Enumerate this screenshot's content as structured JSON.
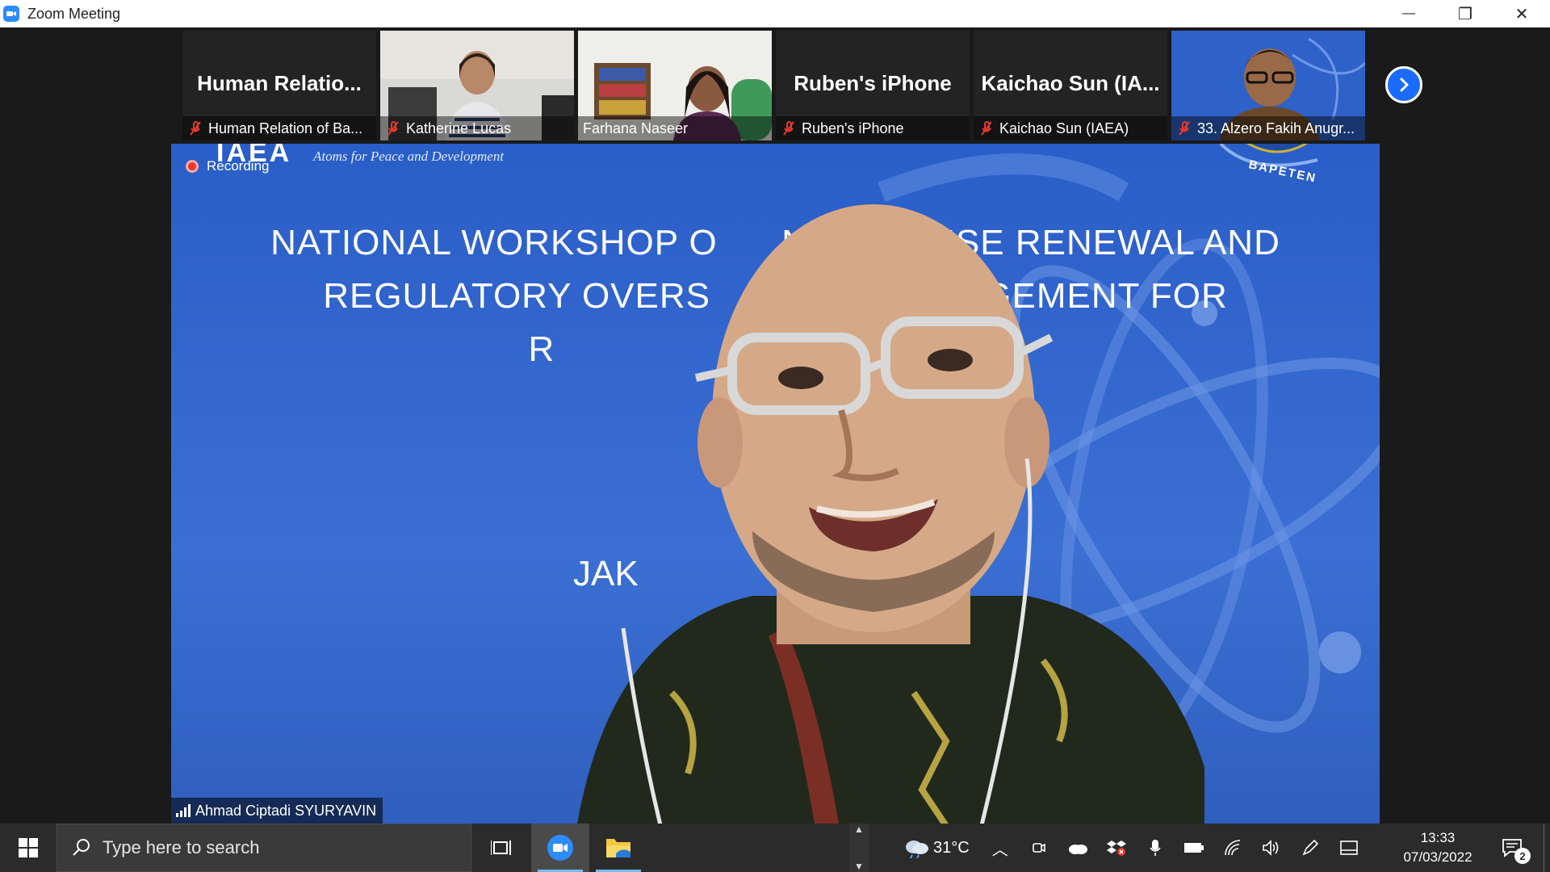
{
  "window": {
    "title": "Zoom Meeting",
    "controls": {
      "minimize": "—",
      "restore": "❐",
      "close": "✕"
    }
  },
  "thumbnails": [
    {
      "display_name": "Human  Relatio...",
      "label": "Human Relation of Ba...",
      "muted": true,
      "has_video": false
    },
    {
      "display_name": "",
      "label": "Katherine Lucas",
      "muted": true,
      "has_video": true
    },
    {
      "display_name": "",
      "label": "Farhana Naseer",
      "muted": false,
      "has_video": true
    },
    {
      "display_name": "Ruben's iPhone",
      "label": "Ruben's iPhone",
      "muted": true,
      "has_video": false
    },
    {
      "display_name": "Kaichao  Sun  (IA...",
      "label": "Kaichao Sun (IAEA)",
      "muted": true,
      "has_video": false
    },
    {
      "display_name": "",
      "label": "33. Alzero Fakih Anugr...",
      "muted": true,
      "has_video": true
    }
  ],
  "main": {
    "recording_label": "Recording",
    "slide_header": "IAEA",
    "slide_subheader": "Atoms for Peace and Development",
    "slide_title_line1": "NATIONAL WORKSHOP O      NG LICENSE RENEWAL AND",
    "slide_title_line2": "REGULATORY OVERS            G MANAGEMENT FOR",
    "slide_title_line3": "R                                    RS",
    "slide_city": "JAK",
    "logo_text": "BAPETEN",
    "speaker_name": "Ahmad Ciptadi SYURYAVIN"
  },
  "taskbar": {
    "search_placeholder": "Type here to search",
    "weather_temp": "31°C",
    "time": "13:33",
    "date": "07/03/2022",
    "notification_count": "2"
  },
  "colors": {
    "zoom_blue": "#2d8cff",
    "slide_blue": "#2f5fc4",
    "muted_red": "#e8372c",
    "taskbar": "#2b2b2b"
  }
}
